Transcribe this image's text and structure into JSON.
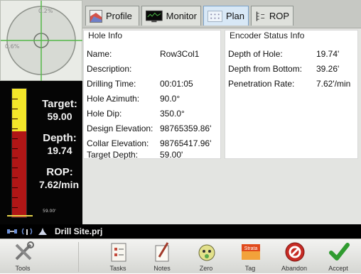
{
  "level": {
    "top_label": "0.2%",
    "left_label": "0.6%"
  },
  "gauge": {
    "target_label": "Target:",
    "target_value": "59.00",
    "depth_label": "Depth:",
    "depth_value": "19.74",
    "rop_label": "ROP:",
    "rop_value": "7.62/min",
    "bottom_label": "59.00'",
    "fill_fraction": 0.33,
    "colors": {
      "fill": "#f4e62a",
      "tube": "#b01616",
      "background": "#050505"
    }
  },
  "tabs": [
    {
      "label": "Profile",
      "icon": "profile-icon"
    },
    {
      "label": "Monitor",
      "icon": "monitor-icon"
    },
    {
      "label": "Plan",
      "icon": "plan-icon"
    },
    {
      "label": "ROP",
      "icon": "rop-icon"
    }
  ],
  "hole_info": {
    "title": "Hole Info",
    "rows": [
      {
        "label": "Name:",
        "value": "Row3Col1"
      },
      {
        "label": "Description:",
        "value": ""
      },
      {
        "label": "Drilling Time:",
        "value": "00:01:05"
      },
      {
        "label": "Hole Azimuth:",
        "value": "90.0°"
      },
      {
        "label": "Hole Dip:",
        "value": "350.0°"
      },
      {
        "label": "Design Elevation:",
        "value": "98765359.86'"
      },
      {
        "label": "Collar Elevation:",
        "value": "98765417.96'"
      },
      {
        "label": "Target Depth:",
        "value": "59.00'"
      }
    ]
  },
  "encoder_info": {
    "title": "Encoder Status Info",
    "rows": [
      {
        "label": "Depth of Hole:",
        "value": "19.74'"
      },
      {
        "label": "Depth from Bottom:",
        "value": "39.26'"
      },
      {
        "label": "Penetration Rate:",
        "value": "7.62'/min"
      }
    ]
  },
  "status_bar": {
    "file_name": "Drill Site.prj"
  },
  "toolbar": {
    "tools": "Tools",
    "tasks": "Tasks",
    "notes": "Notes",
    "zero": "Zero",
    "tag": "Tag",
    "tag_logo": "Strata",
    "abandon": "Abandon",
    "accept": "Accept"
  }
}
